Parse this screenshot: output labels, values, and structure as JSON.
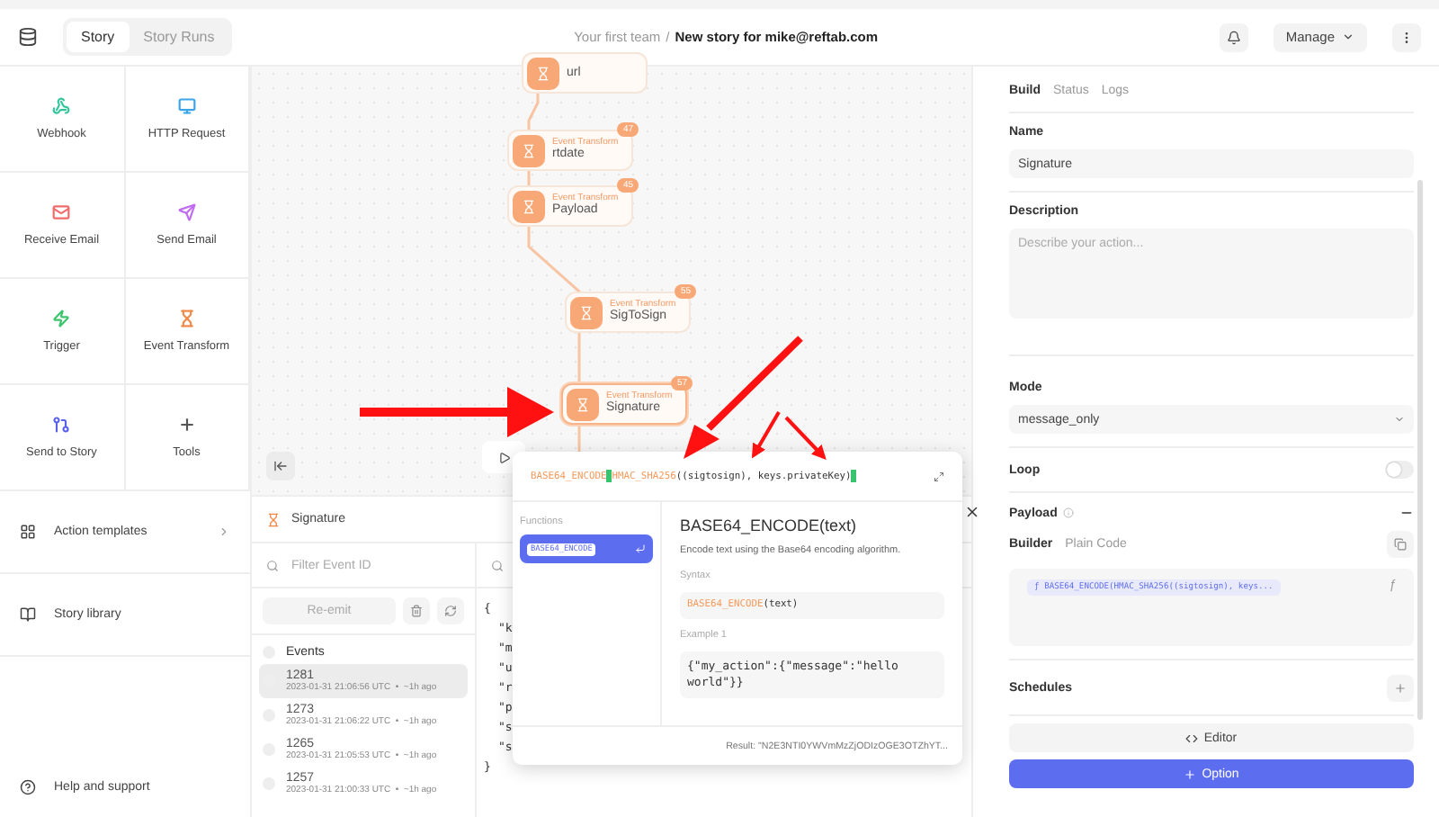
{
  "topbar": {
    "tabs": [
      {
        "label": "Story",
        "selected": true
      },
      {
        "label": "Story Runs",
        "selected": false
      }
    ],
    "breadcrumb": {
      "team": "Your first team",
      "separator": "/",
      "story": "New story for mike@reftab.com"
    },
    "manage": "Manage"
  },
  "actions": [
    {
      "label": "Webhook",
      "kind": "webhook",
      "color": "#2fc79a"
    },
    {
      "label": "HTTP Request",
      "kind": "http",
      "color": "#3aa5e8"
    },
    {
      "label": "Receive Email",
      "kind": "receive",
      "color": "#f26b6b"
    },
    {
      "label": "Send Email",
      "kind": "send",
      "color": "#c06cf0"
    },
    {
      "label": "Trigger",
      "kind": "trigger",
      "color": "#3cc46e"
    },
    {
      "label": "Event Transform",
      "kind": "transform",
      "color": "#f08a4b"
    },
    {
      "label": "Send to Story",
      "kind": "story",
      "color": "#5a63e8"
    },
    {
      "label": "Tools",
      "kind": "tools",
      "color": "#555555"
    }
  ],
  "sidebar_links": [
    {
      "label": "Action templates",
      "kind": "templates"
    },
    {
      "label": "Story library",
      "kind": "library"
    }
  ],
  "help": "Help and support",
  "nodes": [
    {
      "name": "url",
      "selected": false
    },
    {
      "type": "Event Transform",
      "name": "rtdate",
      "badge": "47",
      "selected": false
    },
    {
      "type": "Event Transform",
      "name": "Payload",
      "badge": "45",
      "selected": false
    },
    {
      "type": "Event Transform",
      "name": "SigToSign",
      "badge": "55",
      "selected": false
    },
    {
      "type": "Event Transform",
      "name": "Signature",
      "badge": "57",
      "selected": true
    }
  ],
  "events_panel": {
    "title": "Signature",
    "filter_placeholder": "Filter Event ID",
    "reemit": "Re-emit",
    "events_label": "Events",
    "all_checked": false,
    "events": [
      {
        "id": "1281",
        "meta": "2023-01-31 21:06:56 UTC  •  ~1h ago",
        "selected": true
      },
      {
        "id": "1273",
        "meta": "2023-01-31 21:06:22 UTC  •  ~1h ago",
        "selected": false
      },
      {
        "id": "1265",
        "meta": "2023-01-31 21:05:53 UTC  •  ~1h ago",
        "selected": false
      },
      {
        "id": "1257",
        "meta": "2023-01-31 21:00:33 UTC  •  ~1h ago",
        "selected": false
      }
    ],
    "json_lines": [
      "{",
      "\"k",
      "\"m",
      "\"u",
      "\"r",
      "\"p",
      "\"s",
      "\"s",
      "}"
    ]
  },
  "popup": {
    "code": [
      {
        "kind": "function",
        "text": "BASE64_ENCODE"
      },
      {
        "kind": "cursor"
      },
      {
        "kind": "function",
        "text": "HMAC_SHA256"
      },
      {
        "kind": "text",
        "text": "((sigtosign), keys.privateKey)"
      },
      {
        "kind": "cursor"
      }
    ],
    "functions_label": "Functions",
    "functions": [
      {
        "name": "BASE64_ENCODE",
        "selected": true
      }
    ],
    "detail": {
      "title": "BASE64_ENCODE(text)",
      "description": "Encode text using the Base64 encoding algorithm.",
      "syntax_label": "Syntax",
      "syntax_function": "BASE64_ENCODE",
      "syntax_args": "(text)",
      "example_label": "Example 1",
      "example": "{\"my_action\":{\"message\":\"hello world\"}}"
    },
    "result": "Result: \"N2E3NTI0YWVmMzZjODIzOGE3OTZhYT..."
  },
  "right_panel": {
    "tabs": [
      {
        "label": "Build",
        "selected": true
      },
      {
        "label": "Status",
        "selected": false
      },
      {
        "label": "Logs",
        "selected": false
      }
    ],
    "name_label": "Name",
    "name_value": "Signature",
    "description_label": "Description",
    "description_placeholder": "Describe your action...",
    "mode_label": "Mode",
    "mode_value": "message_only",
    "loop_label": "Loop",
    "loop_on": false,
    "payload_label": "Payload",
    "builder_tabs": [
      {
        "label": "Builder",
        "selected": true
      },
      {
        "label": "Plain Code",
        "selected": false
      }
    ],
    "payload_prefix": "ƒ",
    "payload_icon": "ƒ",
    "payload_value": "BASE64_ENCODE(HMAC_SHA256((sigtosign), keys...",
    "schedules_label": "Schedules",
    "editor_button": "Editor",
    "option_button": "Option"
  }
}
